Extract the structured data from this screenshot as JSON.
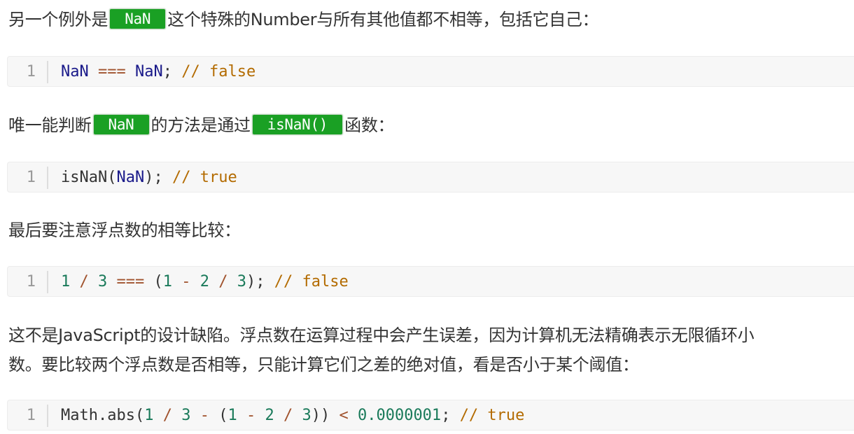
{
  "paragraphs": {
    "p1": {
      "before": "另一个例外是",
      "code": "NaN",
      "after": "这个特殊的Number与所有其他值都不相等，包括它自己："
    },
    "p2": {
      "before": "唯一能判断",
      "code1": "NaN",
      "middle": "的方法是通过",
      "code2": "isNaN()",
      "after": "函数："
    },
    "p3": {
      "text": "最后要注意浮点数的相等比较："
    },
    "p4": {
      "line1": "这不是JavaScript的设计缺陷。浮点数在运算过程中会产生误差，因为计算机无法精确表示无限循环小",
      "line2": "数。要比较两个浮点数是否相等，只能计算它们之差的绝对值，看是否小于某个阈值："
    }
  },
  "code_blocks": [
    {
      "line_number": "1",
      "tokens": [
        {
          "t": "NaN",
          "k": "id"
        },
        {
          "t": " ",
          "k": "plain"
        },
        {
          "t": "===",
          "k": "op"
        },
        {
          "t": " ",
          "k": "plain"
        },
        {
          "t": "NaN",
          "k": "id"
        },
        {
          "t": "; ",
          "k": "plain"
        },
        {
          "t": "// false",
          "k": "com"
        }
      ]
    },
    {
      "line_number": "1",
      "tokens": [
        {
          "t": "isNaN(",
          "k": "plain"
        },
        {
          "t": "NaN",
          "k": "id"
        },
        {
          "t": "); ",
          "k": "plain"
        },
        {
          "t": "// true",
          "k": "com"
        }
      ]
    },
    {
      "line_number": "1",
      "tokens": [
        {
          "t": "1",
          "k": "num"
        },
        {
          "t": " ",
          "k": "plain"
        },
        {
          "t": "/",
          "k": "op"
        },
        {
          "t": " ",
          "k": "plain"
        },
        {
          "t": "3",
          "k": "num"
        },
        {
          "t": " ",
          "k": "plain"
        },
        {
          "t": "===",
          "k": "op"
        },
        {
          "t": " (",
          "k": "plain"
        },
        {
          "t": "1",
          "k": "num"
        },
        {
          "t": " ",
          "k": "plain"
        },
        {
          "t": "-",
          "k": "op"
        },
        {
          "t": " ",
          "k": "plain"
        },
        {
          "t": "2",
          "k": "num"
        },
        {
          "t": " ",
          "k": "plain"
        },
        {
          "t": "/",
          "k": "op"
        },
        {
          "t": " ",
          "k": "plain"
        },
        {
          "t": "3",
          "k": "num"
        },
        {
          "t": "); ",
          "k": "plain"
        },
        {
          "t": "// false",
          "k": "com"
        }
      ]
    },
    {
      "line_number": "1",
      "tokens": [
        {
          "t": "Math.abs(",
          "k": "plain"
        },
        {
          "t": "1",
          "k": "num"
        },
        {
          "t": " ",
          "k": "plain"
        },
        {
          "t": "/",
          "k": "op"
        },
        {
          "t": " ",
          "k": "plain"
        },
        {
          "t": "3",
          "k": "num"
        },
        {
          "t": " ",
          "k": "plain"
        },
        {
          "t": "-",
          "k": "op"
        },
        {
          "t": " (",
          "k": "plain"
        },
        {
          "t": "1",
          "k": "num"
        },
        {
          "t": " ",
          "k": "plain"
        },
        {
          "t": "-",
          "k": "op"
        },
        {
          "t": " ",
          "k": "plain"
        },
        {
          "t": "2",
          "k": "num"
        },
        {
          "t": " ",
          "k": "plain"
        },
        {
          "t": "/",
          "k": "op"
        },
        {
          "t": " ",
          "k": "plain"
        },
        {
          "t": "3",
          "k": "num"
        },
        {
          "t": ")) ",
          "k": "plain"
        },
        {
          "t": "<",
          "k": "op"
        },
        {
          "t": " ",
          "k": "plain"
        },
        {
          "t": "0.0000001",
          "k": "num"
        },
        {
          "t": "; ",
          "k": "plain"
        },
        {
          "t": "// true",
          "k": "com"
        }
      ]
    }
  ],
  "colors": {
    "inline_code_bg": "#1aa024",
    "inline_code_text": "#ffffff",
    "code_block_bg": "#f7f7f7",
    "identifier": "#1a1a8a",
    "operator": "#a0522d",
    "comment": "#b36b00",
    "number": "#1a7a5a"
  }
}
